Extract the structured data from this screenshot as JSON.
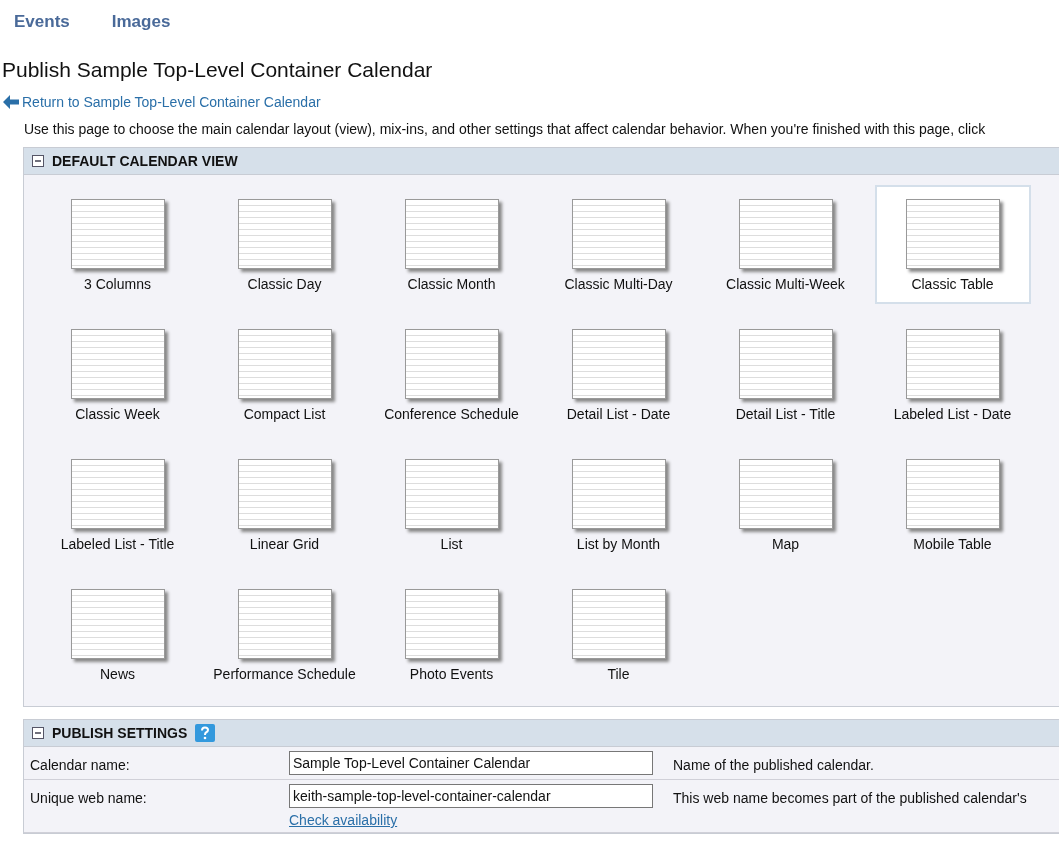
{
  "nav": [
    "Events",
    "Images"
  ],
  "title": "Publish Sample Top-Level Container Calendar",
  "back_link": "Return to Sample Top-Level Container Calendar",
  "intro": "Use this page to choose the main calendar layout (view), mix-ins, and other settings that affect calendar behavior. When you're finished with this page, click",
  "view_panel": {
    "title": "DEFAULT CALENDAR VIEW",
    "expanded": true,
    "views": [
      {
        "label": "3 Columns",
        "selected": false
      },
      {
        "label": "Classic Day",
        "selected": false
      },
      {
        "label": "Classic Month",
        "selected": false
      },
      {
        "label": "Classic Multi-Day",
        "selected": false
      },
      {
        "label": "Classic Multi-Week",
        "selected": false
      },
      {
        "label": "Classic Table",
        "selected": true
      },
      {
        "label": "Classic Week",
        "selected": false
      },
      {
        "label": "Compact List",
        "selected": false
      },
      {
        "label": "Conference Schedule",
        "selected": false
      },
      {
        "label": "Detail List - Date",
        "selected": false
      },
      {
        "label": "Detail List - Title",
        "selected": false
      },
      {
        "label": "Labeled List - Date",
        "selected": false
      },
      {
        "label": "Labeled List - Title",
        "selected": false
      },
      {
        "label": "Linear Grid",
        "selected": false
      },
      {
        "label": "List",
        "selected": false
      },
      {
        "label": "List by Month",
        "selected": false
      },
      {
        "label": "Map",
        "selected": false
      },
      {
        "label": "Mobile Table",
        "selected": false
      },
      {
        "label": "News",
        "selected": false
      },
      {
        "label": "Performance Schedule",
        "selected": false
      },
      {
        "label": "Photo Events",
        "selected": false
      },
      {
        "label": "Tile",
        "selected": false
      }
    ]
  },
  "publish_settings": {
    "title": "PUBLISH SETTINGS",
    "expanded": true,
    "fields": [
      {
        "label": "Calendar name:",
        "value": "Sample Top-Level Container Calendar",
        "hint": "Name of the published calendar."
      },
      {
        "label": "Unique web name:",
        "value": "keith-sample-top-level-container-calendar",
        "link": "Check availability",
        "hint": "This web name becomes part of the published calendar's"
      }
    ]
  }
}
